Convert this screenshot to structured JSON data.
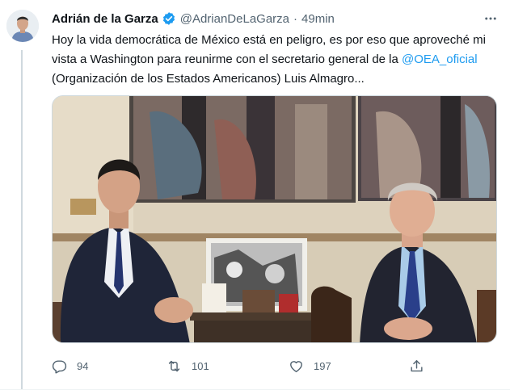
{
  "tweet": {
    "author_name": "Adrián de la Garza",
    "author_handle": "@AdrianDeLaGarza",
    "separator": "·",
    "timestamp": "49min",
    "text_part1": "Hoy la vida democrática de México está en peligro, es por eso que aproveché mi vista a Washington para reunirme con el secretario general de la ",
    "mention": "@OEA_oficial",
    "text_part2": " (Organización de los Estados Americanos) Luis Almagro...",
    "replies": "94",
    "retweets": "101",
    "likes": "197"
  },
  "colors": {
    "accent": "#1d9bf0",
    "muted": "#536471",
    "text": "#0f1419"
  },
  "icons": {
    "verified": "verified-badge-icon",
    "more": "more-horizontal-icon",
    "reply": "reply-icon",
    "retweet": "retweet-icon",
    "like": "heart-icon",
    "share": "share-icon"
  }
}
